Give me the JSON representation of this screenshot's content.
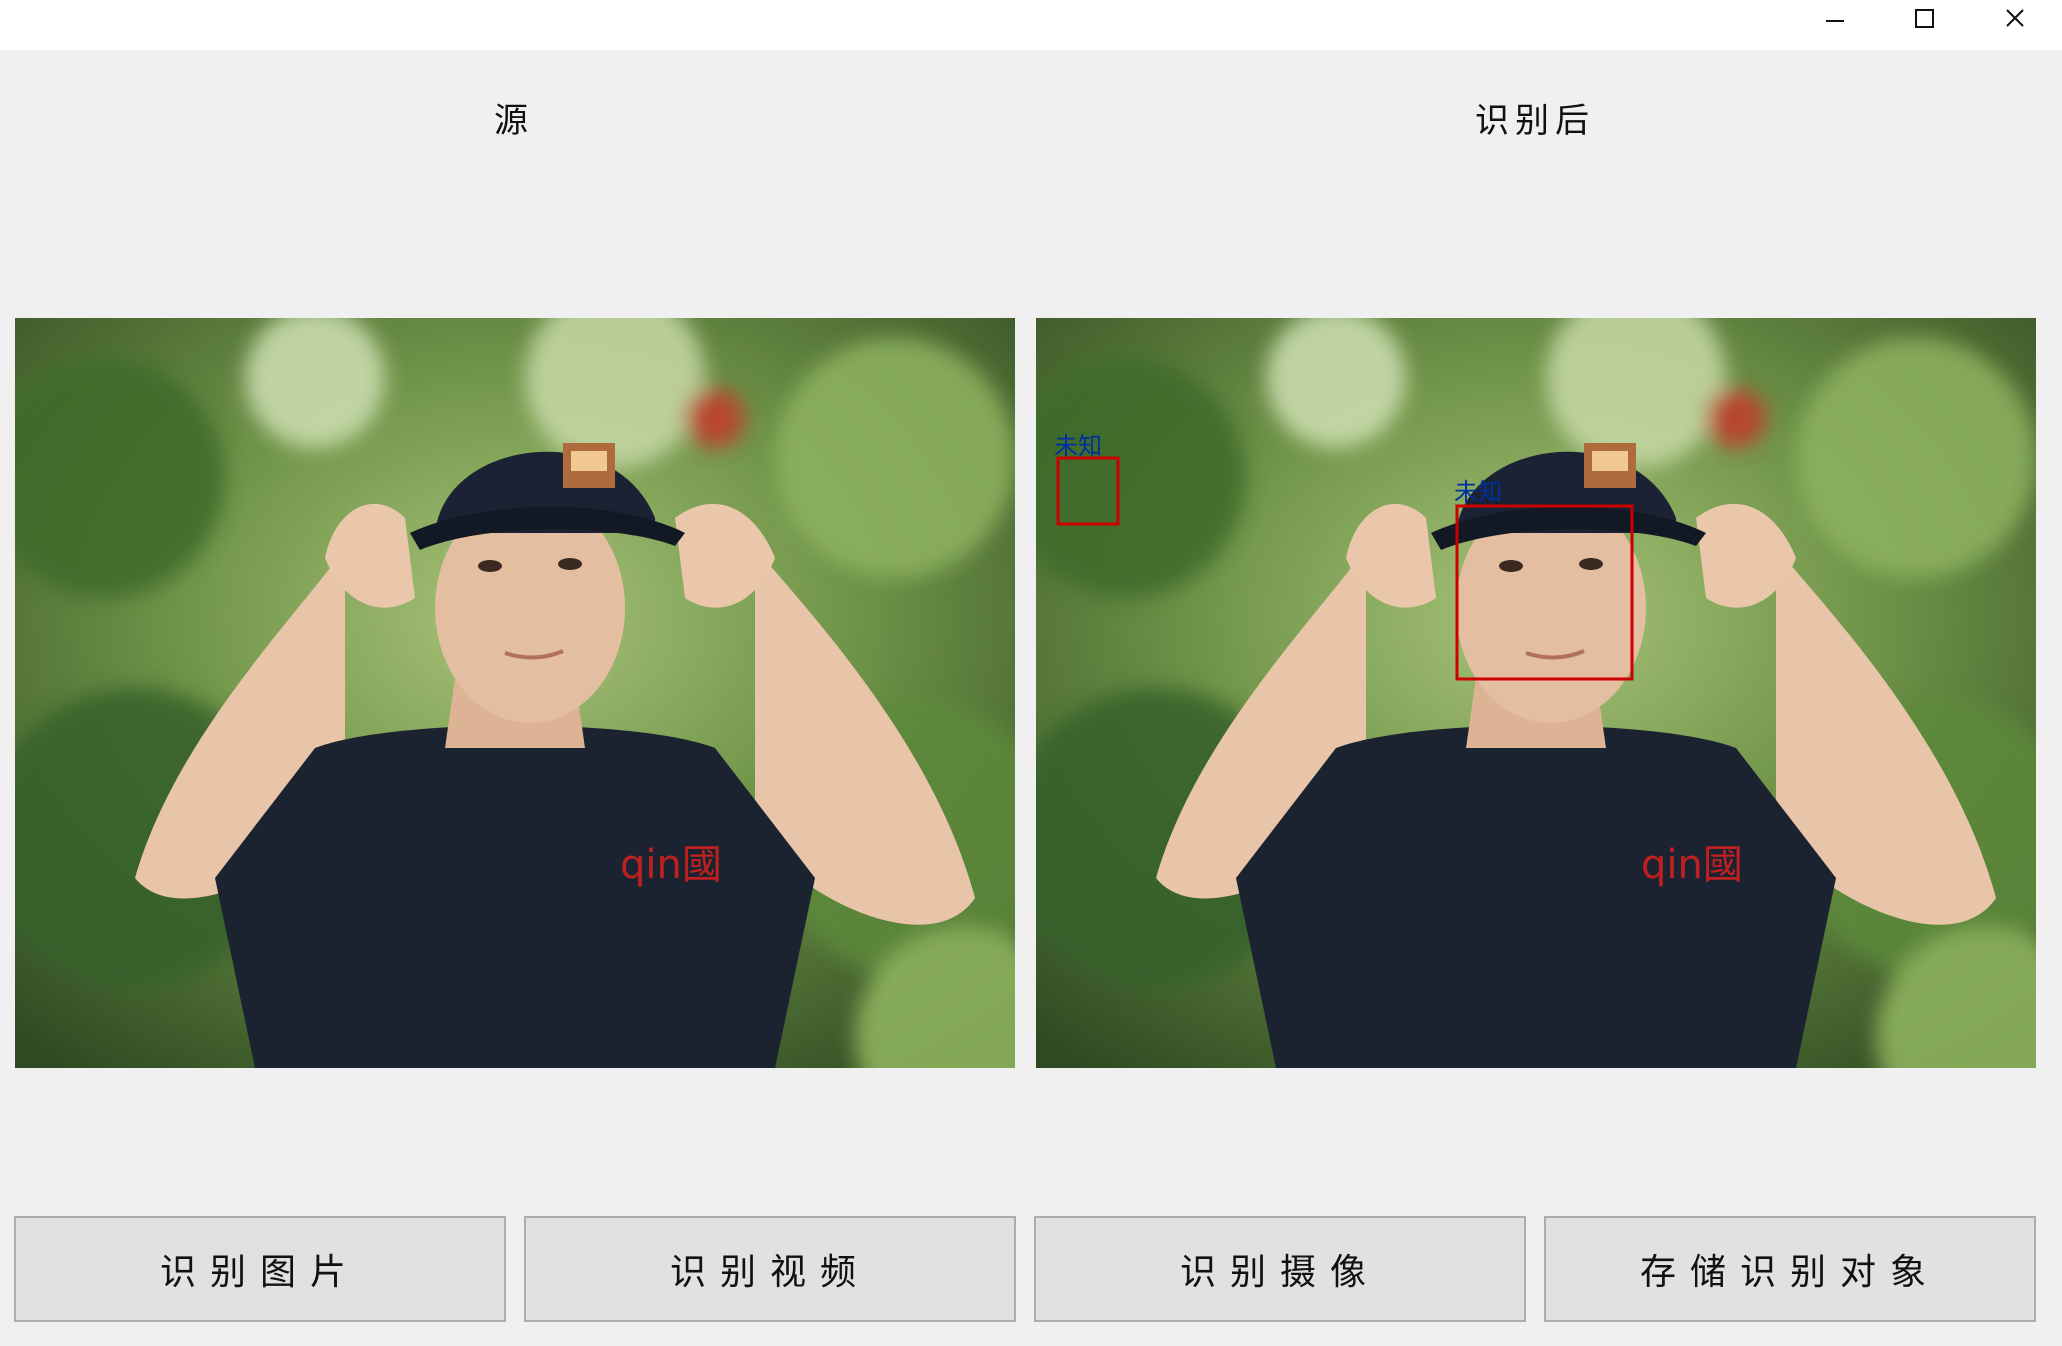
{
  "window": {
    "controls": [
      "minimize-icon",
      "maximize-icon",
      "close-icon"
    ]
  },
  "labels": {
    "source": "源",
    "result": "识别后"
  },
  "detections": [
    {
      "label": "未知",
      "color": "#0030a0",
      "box_color": "#cc0000"
    },
    {
      "label": "未知",
      "color": "#0030a0",
      "box_color": "#cc0000"
    }
  ],
  "shirt_print": "qin國",
  "buttons": {
    "recognize_image": "识别图片",
    "recognize_video": "识别视频",
    "recognize_camera": "识别摄像",
    "save_object": "存储识别对象"
  }
}
